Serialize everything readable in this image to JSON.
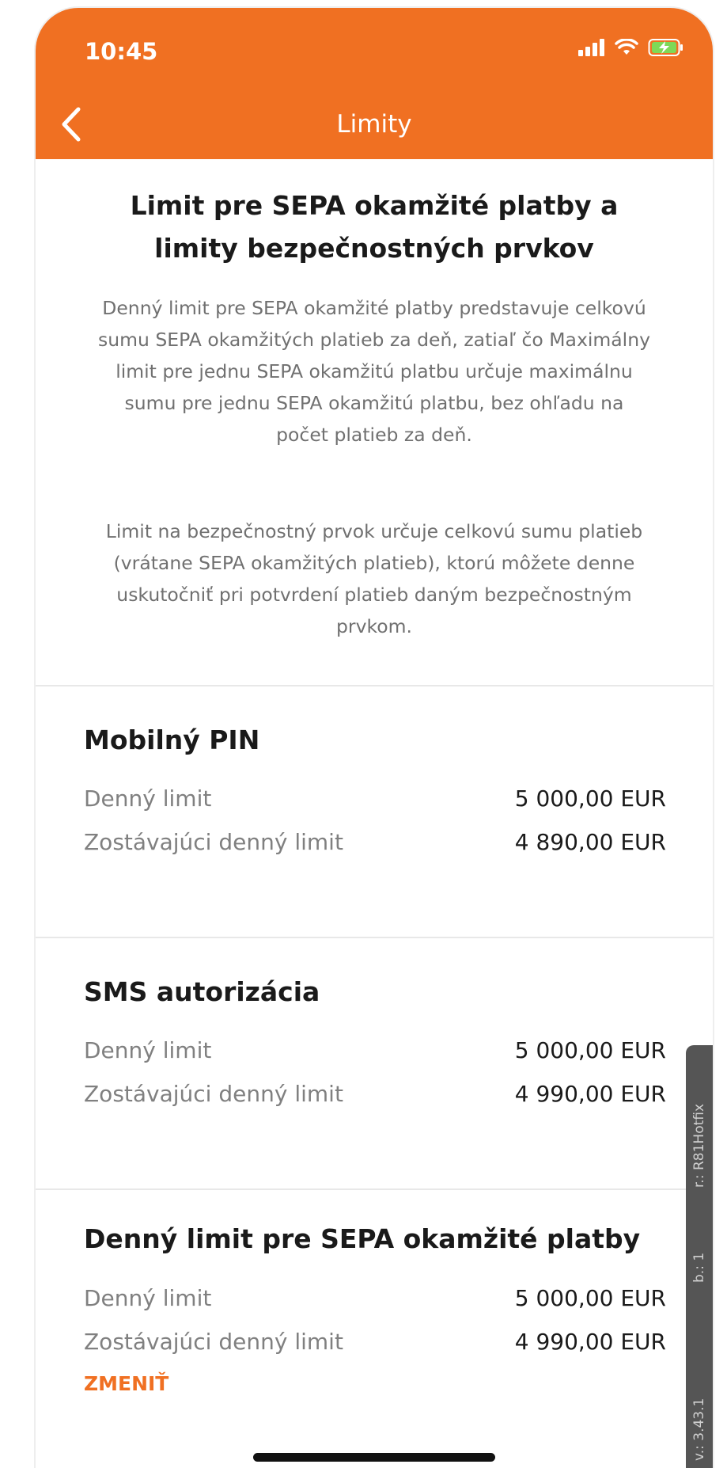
{
  "status_bar": {
    "time": "10:45"
  },
  "nav": {
    "title": "Limity"
  },
  "intro": {
    "heading": "Limit pre SEPA okamžité platby a limity bezpečnostných prvkov",
    "paragraph1": "Denný limit pre SEPA okamžité platby predstavuje celkovú sumu SEPA okamžitých platieb za deň, zatiaľ čo Maximálny limit pre jednu SEPA okamžitú platbu určuje maximálnu sumu pre jednu SEPA okamžitú platbu, bez ohľadu na počet platieb za deň.",
    "paragraph2": "Limit na bezpečnostný prvok určuje celkovú sumu platieb (vrátane SEPA okamžitých platieb), ktorú môžete denne uskutočniť pri potvrdení platieb daným bezpečnostným prvkom."
  },
  "sections": [
    {
      "title": "Mobilný PIN",
      "rows": [
        {
          "label": "Denný limit",
          "value": "5 000,00 EUR"
        },
        {
          "label": "Zostávajúci denný limit",
          "value": "4 890,00 EUR"
        }
      ]
    },
    {
      "title": "SMS autorizácia",
      "rows": [
        {
          "label": "Denný limit",
          "value": "5 000,00 EUR"
        },
        {
          "label": "Zostávajúci denný limit",
          "value": "4 990,00 EUR"
        }
      ]
    },
    {
      "title": "Denný limit pre SEPA okamžité platby",
      "rows": [
        {
          "label": "Denný limit",
          "value": "5 000,00 EUR"
        },
        {
          "label": "Zostávajúci denný limit",
          "value": "4 990,00 EUR"
        }
      ],
      "action": "ZMENIŤ"
    }
  ],
  "version_tab": {
    "revision": "r.: R81Hotfix",
    "build": "b.: 1",
    "version": "v.: 3.43.1"
  },
  "colors": {
    "accent": "#f07022",
    "text": "#1a1a1a",
    "muted": "#808080"
  },
  "icons": {
    "back": "chevron-left-icon",
    "signal": "signal-icon",
    "wifi": "wifi-icon",
    "battery": "battery-charging-icon"
  }
}
